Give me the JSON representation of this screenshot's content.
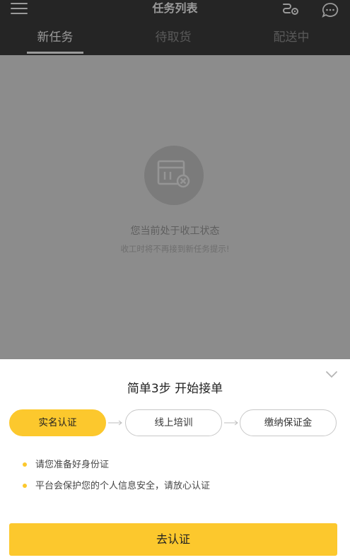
{
  "header": {
    "title": "任务列表",
    "tabs": [
      {
        "label": "新任务"
      },
      {
        "label": "待取货"
      },
      {
        "label": "配送中"
      }
    ]
  },
  "status": {
    "title": "您当前处于收工状态",
    "subtitle": "收工时将不再接到新任务提示!"
  },
  "sheet": {
    "title": "简单3步 开始接单",
    "steps": [
      {
        "label": "实名认证"
      },
      {
        "label": "线上培训"
      },
      {
        "label": "缴纳保证金"
      }
    ],
    "notes": [
      "请您准备好身份证",
      "平台会保护您的个人信息安全，请放心认证"
    ],
    "cta": "去认证"
  },
  "colors": {
    "accent": "#fcc82d",
    "header_bg": "#252525",
    "overlay": "#8c8c8c"
  },
  "icons": [
    "menu-icon",
    "route-icon",
    "chat-icon",
    "shop-closed-icon",
    "chevron-down-icon",
    "arrow-right-icon"
  ]
}
